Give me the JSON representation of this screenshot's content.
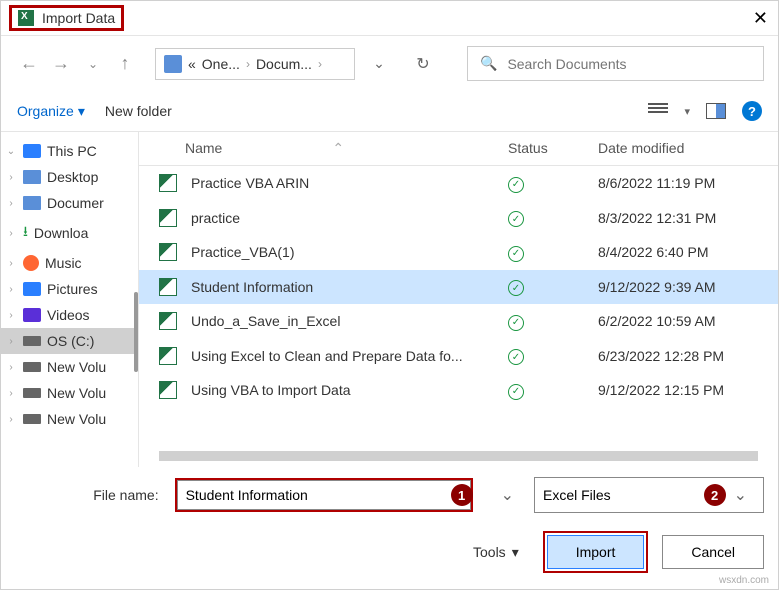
{
  "titlebar": {
    "title": "Import Data"
  },
  "breadcrumb": {
    "seg1": "One...",
    "seg2": "Docum..."
  },
  "search": {
    "placeholder": "Search Documents"
  },
  "toolbar": {
    "organize": "Organize",
    "newfolder": "New folder"
  },
  "sidebar": {
    "items": [
      {
        "label": "This PC"
      },
      {
        "label": "Desktop"
      },
      {
        "label": "Documer"
      },
      {
        "label": "Downloa"
      },
      {
        "label": "Music"
      },
      {
        "label": "Pictures"
      },
      {
        "label": "Videos"
      },
      {
        "label": "OS (C:)"
      },
      {
        "label": "New Volu"
      },
      {
        "label": "New Volu"
      },
      {
        "label": "New Volu"
      }
    ]
  },
  "columns": {
    "name": "Name",
    "status": "Status",
    "date": "Date modified"
  },
  "files": [
    {
      "name": "Practice VBA ARIN",
      "date": "8/6/2022 11:19 PM"
    },
    {
      "name": "practice",
      "date": "8/3/2022 12:31 PM"
    },
    {
      "name": "Practice_VBA(1)",
      "date": "8/4/2022 6:40 PM"
    },
    {
      "name": "Student Information",
      "date": "9/12/2022 9:39 AM"
    },
    {
      "name": "Undo_a_Save_in_Excel",
      "date": "6/2/2022 10:59 AM"
    },
    {
      "name": "Using Excel to Clean and Prepare Data fo...",
      "date": "6/23/2022 12:28 PM"
    },
    {
      "name": "Using VBA to Import Data",
      "date": "9/12/2022 12:15 PM"
    }
  ],
  "footer": {
    "filename_label": "File name:",
    "filename_value": "Student Information",
    "filter": "Excel Files",
    "tools": "Tools",
    "import": "Import",
    "cancel": "Cancel",
    "badge1": "1",
    "badge2": "2"
  },
  "watermark": "wsxdn.com"
}
